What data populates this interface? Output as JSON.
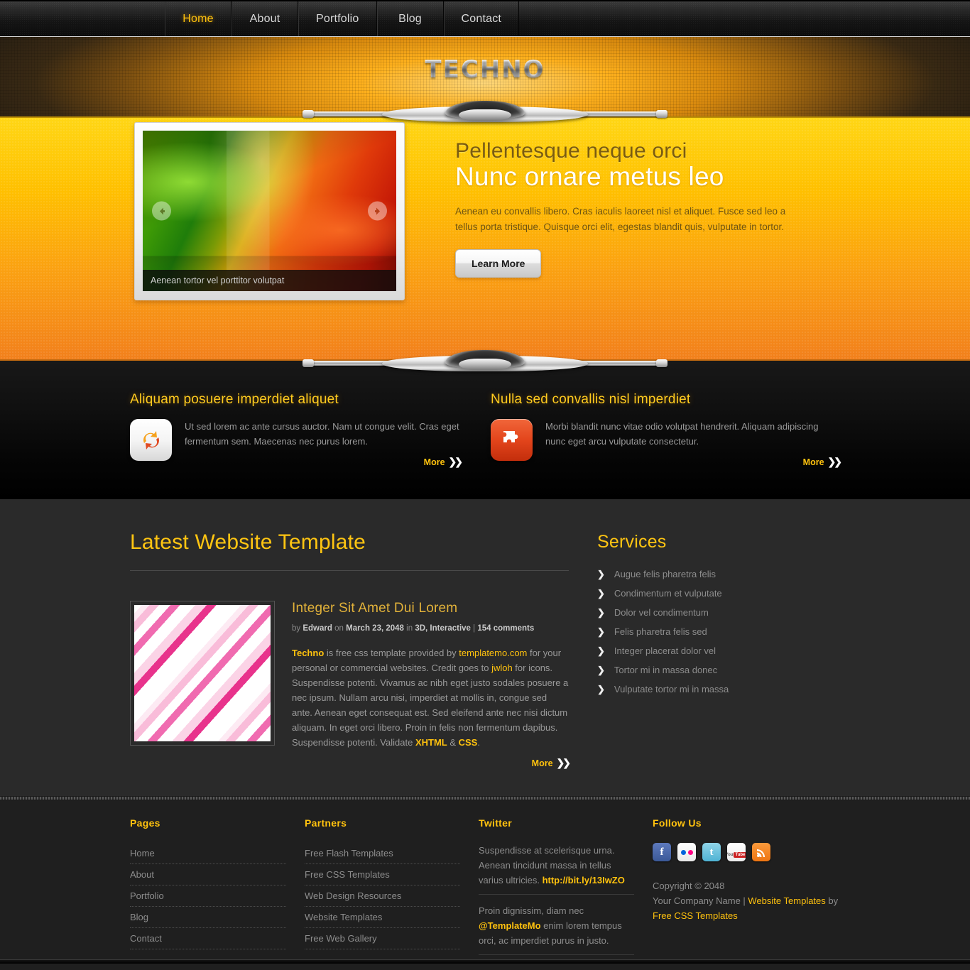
{
  "nav": {
    "items": [
      {
        "label": "Home",
        "active": true
      },
      {
        "label": "About",
        "active": false
      },
      {
        "label": "Portfolio",
        "active": false
      },
      {
        "label": "Blog",
        "active": false
      },
      {
        "label": "Contact",
        "active": false
      }
    ]
  },
  "header": {
    "logo": "TECHNO"
  },
  "banner": {
    "slide_caption": "Aenean tortor vel porttitor volutpat",
    "heading_small": "Pellentesque neque orci",
    "heading_large": "Nunc ornare metus leo",
    "paragraph": "Aenean eu convallis libero. Cras iaculis laoreet nisl et aliquet. Fusce sed leo a tellus porta tristique. Quisque orci elit, egestas blandit quis, vulputate in tortor.",
    "button_label": "Learn More",
    "prev_icon": "arrow-left-icon",
    "next_icon": "arrow-right-icon"
  },
  "features": [
    {
      "title": "Aliquam posuere imperdiet aliquet",
      "text": "Ut sed lorem ac ante cursus auctor. Nam ut congue velit. Cras eget fermentum sem. Maecenas nec purus lorem.",
      "icon": "refresh-icon",
      "more_label": "More"
    },
    {
      "title": "Nulla sed convallis nisl imperdiet",
      "text": "Morbi blandit nunc vitae odio volutpat hendrerit. Aliquam adipiscing nunc eget arcu vulputate consectetur.",
      "icon": "puzzle-icon",
      "more_label": "More"
    }
  ],
  "main": {
    "content_title": "Latest Website Template",
    "post": {
      "title": "Integer Sit Amet Dui Lorem",
      "meta_by": "by",
      "meta_author": "Edward",
      "meta_on": "on",
      "meta_date": "March 23, 2048",
      "meta_in": "in",
      "meta_cats": "3D, Interactive",
      "meta_divider": "|",
      "meta_comments": "154 comments",
      "body_1": "Techno",
      "body_2": " is free css template provided by ",
      "body_3": "templatemo.com",
      "body_4": " for your personal or commercial websites. Credit goes to ",
      "body_5": "jwloh",
      "body_6": " for icons. Suspendisse potenti. Vivamus ac nibh eget justo sodales posuere a nec ipsum. Nullam arcu nisi, imperdiet at mollis in, congue sed ante. Aenean eget consequat est. Sed eleifend ante nec nisi dictum aliquam. In eget orci libero. Proin in felis non fermentum dapibus. Suspendisse potenti. Validate ",
      "body_7": "XHTML",
      "body_8": " & ",
      "body_9": "CSS",
      "body_10": ".",
      "more_label": "More"
    }
  },
  "sidebar": {
    "title": "Services",
    "items": [
      "Augue felis pharetra felis",
      "Condimentum et vulputate",
      "Dolor vel condimentum",
      "Felis pharetra felis sed",
      "Integer placerat dolor vel",
      "Tortor mi in massa donec",
      "Vulputate tortor mi in massa"
    ]
  },
  "footer": {
    "pages": {
      "title": "Pages",
      "items": [
        "Home",
        "About",
        "Portfolio",
        "Blog",
        "Contact"
      ]
    },
    "partners": {
      "title": "Partners",
      "items": [
        "Free Flash Templates",
        "Free CSS Templates",
        "Web Design Resources",
        "Website Templates",
        "Free Web Gallery"
      ]
    },
    "twitter": {
      "title": "Twitter",
      "tweet1_text": "Suspendisse at scelerisque urna. Aenean tincidunt massa in tellus varius ultricies. ",
      "tweet1_link": "http://bit.ly/13IwZO",
      "tweet2_pre": "Proin dignissim, diam nec ",
      "tweet2_handle": "@TemplateMo",
      "tweet2_post": " enim lorem tempus orci, ac imperdiet purus in justo."
    },
    "follow": {
      "title": "Follow Us",
      "socials": [
        {
          "name": "facebook-icon",
          "glyph": "f"
        },
        {
          "name": "flickr-icon",
          "glyph": ""
        },
        {
          "name": "twitter-icon",
          "glyph": "t"
        },
        {
          "name": "youtube-icon",
          "glyph": "You"
        },
        {
          "name": "rss-icon",
          "glyph": ""
        }
      ],
      "copyright": "Copyright © 2048",
      "company": "Your Company Name",
      "sep": " | ",
      "link1": "Website Templates",
      "by": " by ",
      "link2": "Free CSS Templates"
    }
  },
  "colors": {
    "accent_yellow": "#ffc20e",
    "banner_top": "#ffd615",
    "banner_bottom": "#f2801c",
    "main_bg": "#2a2a2a",
    "footer_bg": "#1f1f1f"
  }
}
